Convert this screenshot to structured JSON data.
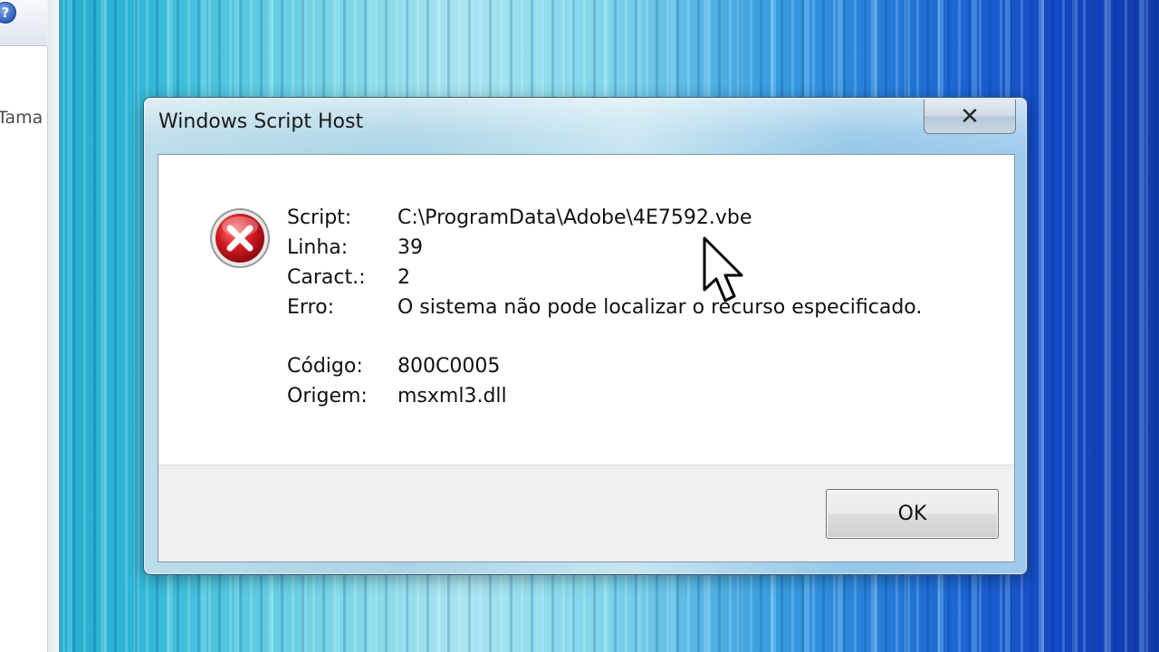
{
  "background": {
    "help_glyph": "?",
    "column_header_fragment": "Tama"
  },
  "dialog": {
    "title": "Windows Script Host",
    "close_glyph": "✕",
    "icon": "error-icon",
    "fields": [
      {
        "label": "Script:",
        "value": "C:\\ProgramData\\Adobe\\4E7592.vbe"
      },
      {
        "label": "Linha:",
        "value": "39"
      },
      {
        "label": "Caract.:",
        "value": "2"
      },
      {
        "label": "Erro:",
        "value": "O sistema não pode localizar o recurso especificado."
      },
      {
        "label": "",
        "value": ""
      },
      {
        "label": "Código:",
        "value": "800C0005"
      },
      {
        "label": "Origem:",
        "value": "msxml3.dll"
      }
    ],
    "ok_label": "OK"
  },
  "colors": {
    "error_red": "#c8101a",
    "dialog_frame": "#a6d2e6",
    "button_area": "#f0f0f0"
  }
}
